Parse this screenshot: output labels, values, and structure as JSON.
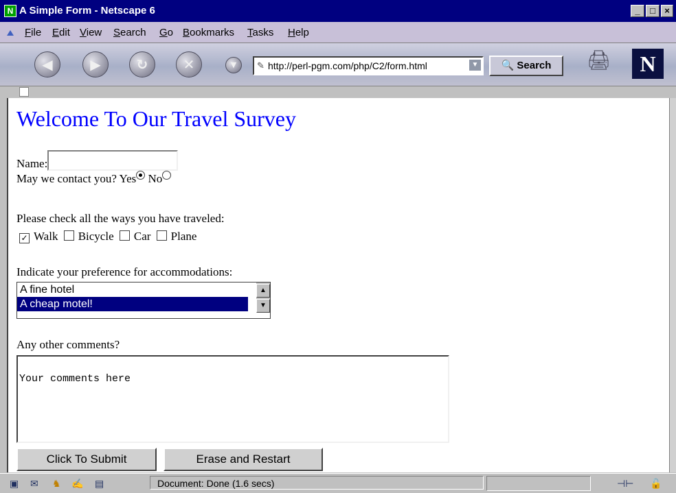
{
  "window": {
    "title": "A Simple Form - Netscape 6",
    "app_icon": "N",
    "min_glyph": "_",
    "max_glyph": "□",
    "close_glyph": "×"
  },
  "menu": [
    {
      "ul": "F",
      "rest": "ile"
    },
    {
      "ul": "E",
      "rest": "dit"
    },
    {
      "ul": "V",
      "rest": "iew"
    },
    {
      "ul": "S",
      "rest": "earch"
    },
    {
      "ul": "G",
      "rest": "o"
    },
    {
      "ul": "B",
      "rest": "ookmarks"
    },
    {
      "ul": "T",
      "rest": "asks"
    },
    {
      "ul": "H",
      "rest": "elp"
    }
  ],
  "toolbar": {
    "back_glyph": "◀",
    "forward_glyph": "▶",
    "reload_glyph": "↻",
    "stop_glyph": "✕",
    "url": "http://perl-pgm.com/php/C2/form.html",
    "search_label": "Search",
    "logo": "N"
  },
  "page": {
    "heading": "Welcome To Our Travel Survey",
    "name_label": "Name:",
    "contact_question": "May we contact you?",
    "yes_label": "Yes",
    "no_label": "No",
    "travel_question": "Please check all the ways you have traveled:",
    "travel_options": [
      {
        "label": "Walk",
        "checked": true,
        "mark": "✓"
      },
      {
        "label": "Bicycle",
        "checked": false,
        "mark": ""
      },
      {
        "label": "Car",
        "checked": false,
        "mark": ""
      },
      {
        "label": "Plane",
        "checked": false,
        "mark": ""
      }
    ],
    "accommodation_question": "Indicate your preference for accommodations:",
    "accommodation_options": [
      "A fine hotel",
      "A cheap motel!"
    ],
    "selected_accommodation": "A cheap motel!",
    "comments_label": "Any other comments?",
    "comments_value": "Your comments here",
    "submit_label": "Click To Submit",
    "reset_label": "Erase and Restart"
  },
  "status": {
    "text": "Document: Done (1.6 secs)"
  },
  "icons": [
    "netscape-icon",
    "mail-icon",
    "aim-icon",
    "composer-icon",
    "address-book-icon",
    "connection-icon",
    "lock-icon"
  ]
}
